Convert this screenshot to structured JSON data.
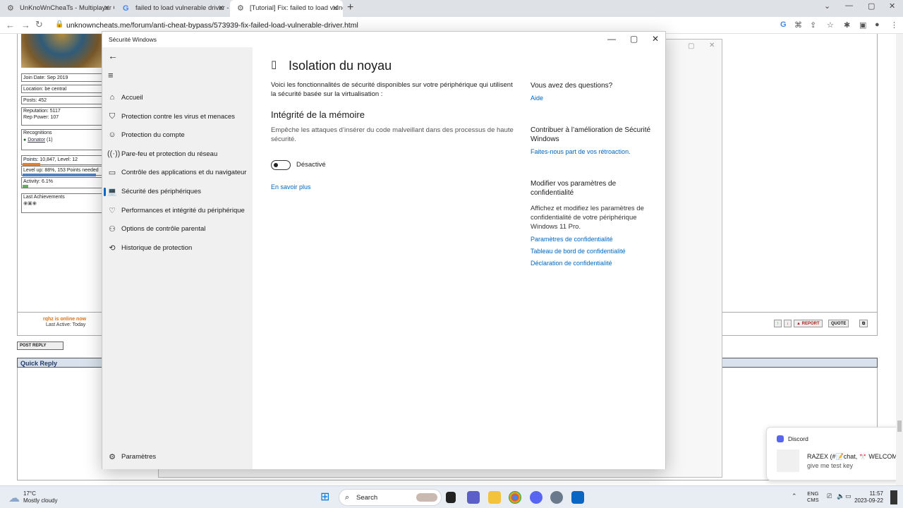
{
  "browser": {
    "tabs": [
      {
        "label": "UnKnoWnCheaTs - Multiplayer G",
        "icon": "uc-icon"
      },
      {
        "label": "failed to load vulnerable driver - G",
        "icon": "google-icon"
      },
      {
        "label": "[Tutorial] Fix: failed to load vulne",
        "icon": "uc-icon"
      }
    ],
    "url": "unknowncheats.me/forum/anti-cheat-bypass/573939-fix-failed-load-vulnerable-driver.html"
  },
  "forum": {
    "join_date": "Join Date: Sep 2019",
    "location": "Location: be central",
    "posts": "Posts: 452",
    "reputation": "Reputation: 5117",
    "rep_power": "Rep Power: 107",
    "recognitions_label": "Recognitions",
    "donator": "Donator",
    "donator_count": "(1)",
    "points": "Points: 10,847, Level: 12",
    "level_up": "Level up: 88%, 153 Points needed",
    "activity": "Activity: 6.1%",
    "last_achievements": "Last Achievements",
    "online": "rqhz is online now",
    "last_active": "Last Active: Today",
    "post_reply": "POST REPLY",
    "quick_reply": "Quick Reply",
    "report": "REPORT",
    "quote": "QUOTE"
  },
  "ws": {
    "window_title": "Sécurité Windows",
    "nav": [
      {
        "label": "Accueil",
        "icon": "home-icon"
      },
      {
        "label": "Protection contre les virus et menaces",
        "icon": "shield-icon"
      },
      {
        "label": "Protection du compte",
        "icon": "person-icon"
      },
      {
        "label": "Pare-feu et protection du réseau",
        "icon": "wifi-icon"
      },
      {
        "label": "Contrôle des applications et du navigateur",
        "icon": "app-browser-icon"
      },
      {
        "label": "Sécurité des périphériques",
        "icon": "laptop-icon"
      },
      {
        "label": "Performances et intégrité du périphérique",
        "icon": "heart-icon"
      },
      {
        "label": "Options de contrôle parental",
        "icon": "family-icon"
      },
      {
        "label": "Historique de protection",
        "icon": "history-icon"
      }
    ],
    "settings": "Paramètres",
    "page_title": "Isolation du noyau",
    "intro": "Voici les fonctionnalités de sécurité disponibles sur votre périphérique qui utilisent la sécurité basée sur la virtualisation :",
    "section_title": "Intégrité de la mémoire",
    "section_desc": "Empêche les attaques d’insérer du code malveillant dans des processus de haute sécurité.",
    "toggle_state": "Désactivé",
    "learn_more": "En savoir plus",
    "right": {
      "questions_title": "Vous avez des questions?",
      "help": "Aide",
      "improve_title": "Contribuer à l’amélioration de Sécurité Windows",
      "feedback": "Faites-nous part de vos rétroaction.",
      "privacy_title": "Modifier vos paramètres de confidentialité",
      "privacy_desc": "Affichez et modifiez les paramètres de confidentialité de votre périphérique Windows 11 Pro.",
      "privacy_settings": "Paramètres de confidentialité",
      "privacy_dashboard": "Tableau de bord de confidentialité",
      "privacy_statement": "Déclaration de confidentialité"
    }
  },
  "toast": {
    "app": "Discord",
    "title": "RAZEX (#📝chat, 🎌 WELCOME",
    "message": "give me test key"
  },
  "taskbar": {
    "temp": "17°C",
    "condition": "Mostly cloudy",
    "search": "Search",
    "lang1": "ENG",
    "lang2": "CMS",
    "time": "11:57",
    "date": "2023-09-22"
  }
}
